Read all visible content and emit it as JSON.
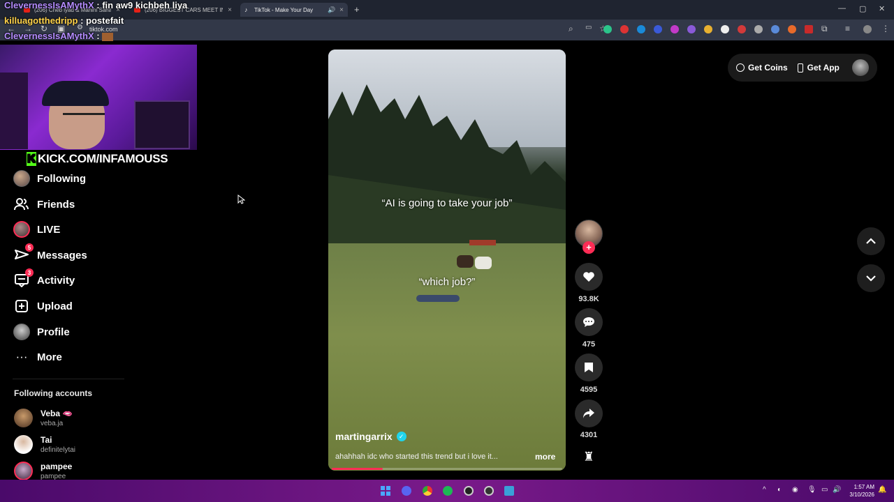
{
  "browser": {
    "tabs": [
      {
        "label": "(206) Cheb iyad & Manini Sahar"
      },
      {
        "label": "(206) BIGGEST CARS MEET IN M"
      },
      {
        "label": "TikTok - Make Your Day"
      }
    ],
    "new_tab": "+",
    "url": "tiktok.com"
  },
  "chat": [
    {
      "user": "ClevernessIsAMythX",
      "msg": ": fin aw9 kichbeh liya"
    },
    {
      "user": "killuagotthedripp",
      "msg": ": postefait"
    },
    {
      "user": "ClevernessIsAMythX",
      "msg": ":"
    }
  ],
  "stream": {
    "kick_url": "KICK.COM/INFAMOUSS",
    "kick_letter": "K"
  },
  "sidebar": {
    "items": [
      {
        "label": "Following"
      },
      {
        "label": "Friends"
      },
      {
        "label": "LIVE"
      },
      {
        "label": "Messages",
        "badge": "5"
      },
      {
        "label": "Activity",
        "badge": "3"
      },
      {
        "label": "Upload"
      },
      {
        "label": "Profile"
      },
      {
        "label": "More"
      }
    ],
    "following_title": "Following accounts",
    "accounts": [
      {
        "name": "Veba 🫦",
        "handle": "veba.ja"
      },
      {
        "name": "Tai",
        "handle": "definitelytai"
      },
      {
        "name": "pampee",
        "handle": "pampee"
      }
    ]
  },
  "video": {
    "caption_top": "“AI is going to take your job”",
    "caption_mid": "“which job?”",
    "username": "martingarrix",
    "description": "ahahhah idc who started this trend but i love it...",
    "more": "more",
    "progress": 0.22
  },
  "actions": {
    "likes": "93.8K",
    "comments": "475",
    "saves": "4595",
    "shares": "4301"
  },
  "topright": {
    "coins": "Get Coins",
    "app": "Get App"
  },
  "taskbar": {
    "time": "1:57 AM",
    "date": "3/10/2026"
  },
  "colors": {
    "accent": "#fe2c55",
    "verified": "#20d5ec",
    "kick": "#53fc18"
  }
}
